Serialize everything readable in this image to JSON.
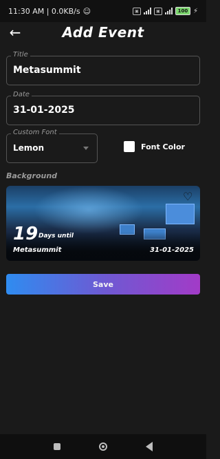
{
  "status": {
    "time_speed": "11:30 AM | 0.0KB/s",
    "battery": "100"
  },
  "appbar": {
    "title": "Add Event"
  },
  "form": {
    "title_label": "Title",
    "title_value": "Metasummit",
    "date_label": "Date",
    "date_value": "31-01-2025",
    "font_label": "Custom Font",
    "font_value": "Lemon",
    "font_color_label": "Font Color",
    "background_label": "Background"
  },
  "card": {
    "days": "19",
    "days_until": "Days until",
    "event": "Metasummit",
    "date": "31-01-2025"
  },
  "actions": {
    "save": "Save"
  },
  "colors": {
    "background": "#1a1a1a",
    "save_gradient_start": "#2f8cf0",
    "save_gradient_end": "#a23bc7"
  },
  "icons": {
    "back": "arrow-left-icon",
    "favorite": "heart-icon",
    "dropdown": "chevron-down-icon"
  }
}
